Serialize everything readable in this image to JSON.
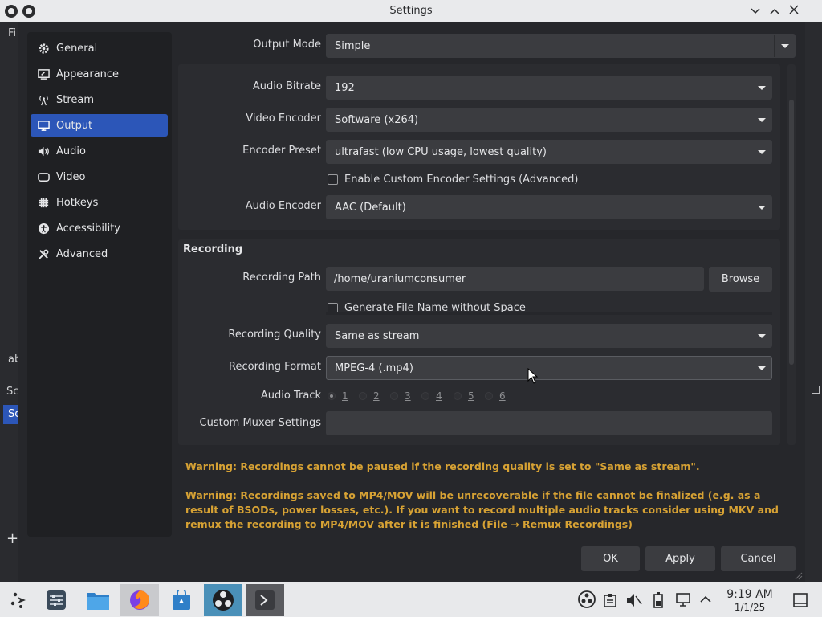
{
  "window": {
    "title": "Settings"
  },
  "sidebar": {
    "items": [
      {
        "label": "General",
        "icon": "gear-icon"
      },
      {
        "label": "Appearance",
        "icon": "appearance-icon"
      },
      {
        "label": "Stream",
        "icon": "antenna-icon"
      },
      {
        "label": "Output",
        "icon": "monitor-icon",
        "active": true
      },
      {
        "label": "Audio",
        "icon": "speaker-icon"
      },
      {
        "label": "Video",
        "icon": "video-icon"
      },
      {
        "label": "Hotkeys",
        "icon": "keyboard-icon"
      },
      {
        "label": "Accessibility",
        "icon": "accessibility-icon"
      },
      {
        "label": "Advanced",
        "icon": "wrench-icon"
      }
    ]
  },
  "output_mode": {
    "label": "Output Mode",
    "value": "Simple"
  },
  "streaming": {
    "audio_bitrate": {
      "label": "Audio Bitrate",
      "value": "192"
    },
    "video_encoder": {
      "label": "Video Encoder",
      "value": "Software (x264)"
    },
    "encoder_preset": {
      "label": "Encoder Preset",
      "value": "ultrafast (low CPU usage, lowest quality)"
    },
    "custom_encoder_checkbox": "Enable Custom Encoder Settings (Advanced)",
    "audio_encoder": {
      "label": "Audio Encoder",
      "value": "AAC (Default)"
    }
  },
  "recording": {
    "heading": "Recording",
    "path": {
      "label": "Recording Path",
      "value": "/home/uraniumconsumer"
    },
    "browse": "Browse",
    "filename_checkbox": "Generate File Name without Space",
    "quality": {
      "label": "Recording Quality",
      "value": "Same as stream"
    },
    "format": {
      "label": "Recording Format",
      "value": "MPEG-4 (.mp4)"
    },
    "audio_track": {
      "label": "Audio Track",
      "tracks": [
        "1",
        "2",
        "3",
        "4",
        "5",
        "6"
      ]
    },
    "muxer": {
      "label": "Custom Muxer Settings",
      "value": ""
    }
  },
  "warnings": {
    "w1": "Warning: Recordings cannot be paused if the recording quality is set to \"Same as stream\".",
    "w2": "Warning: Recordings saved to MP4/MOV will be unrecoverable if the file cannot be finalized (e.g. as a result of BSODs, power losses, etc.). If you want to record multiple audio tracks consider using MKV and remux the recording to MP4/MOV after it is finished (File → Remux Recordings)"
  },
  "buttons": {
    "ok": "OK",
    "apply": "Apply",
    "cancel": "Cancel"
  },
  "background": {
    "file_menu": "Fi",
    "ab": "ab",
    "sc": "Sc",
    "sc2": "Sc",
    "plus": "+"
  },
  "taskbar": {
    "time": "9:19 AM",
    "date": "1/1/25"
  },
  "colors": {
    "accent": "#2c56b8",
    "warning": "#d7a234",
    "dialog_bg": "#26272b"
  }
}
